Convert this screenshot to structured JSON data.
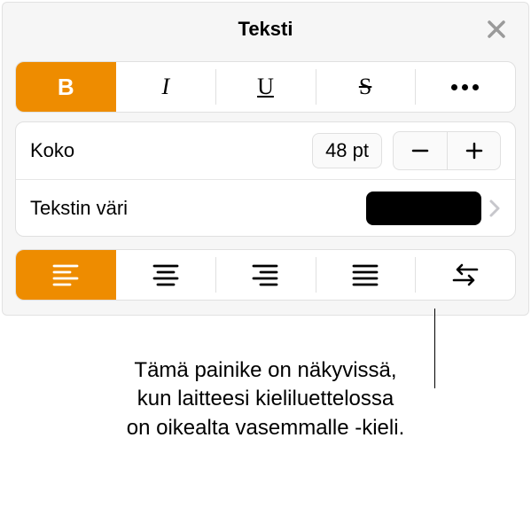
{
  "header": {
    "title": "Teksti"
  },
  "style_segment": {
    "bold": "B",
    "italic": "I",
    "underline": "U",
    "strike": "S"
  },
  "rows": {
    "size_label": "Koko",
    "size_value": "48 pt",
    "color_label": "Tekstin väri",
    "color_value": "#000000"
  },
  "callout": {
    "line1": "Tämä painike on näkyvissä,",
    "line2": "kun laitteesi kieliluettelossa",
    "line3": "on oikealta vasemmalle -kieli."
  }
}
